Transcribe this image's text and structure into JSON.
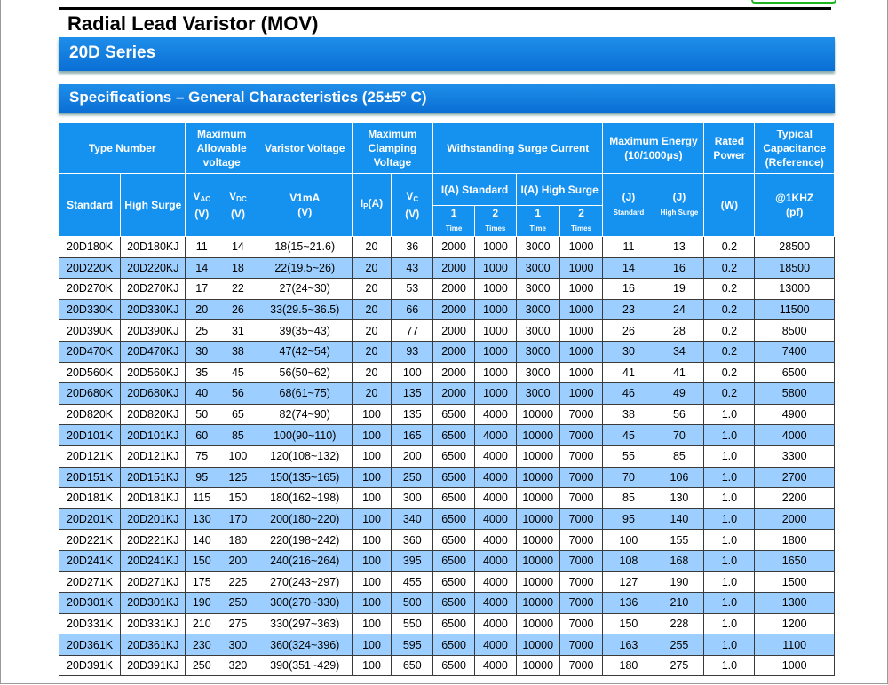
{
  "title": "Radial Lead Varistor (MOV)",
  "series": "20D Series",
  "section": "Specifications – General Characteristics (25±5° C)",
  "headers": {
    "type_number": "Type Number",
    "max_allowable_voltage": "Maximum Allowable voltage",
    "varistor_voltage": "Varistor Voltage",
    "max_clamping_voltage": "Maximum Clamping Voltage",
    "withstanding_surge": "Withstanding Surge Current",
    "max_energy": "Maximum Energy (10/1000μs)",
    "rated_power": "Rated Power",
    "typical_capacitance": "Typical Capacitance (Reference)",
    "standard": "Standard",
    "high_surge": "High Surge",
    "vac_unit": "(V)",
    "vdc_unit": "(V)",
    "v1ma": "V1mA",
    "v1ma_unit": "(V)",
    "ip_unit": "(A)",
    "vc_unit": "(V)",
    "ia_standard": "I(A) Standard",
    "ia_high_surge": "I(A) High Surge",
    "one": "1",
    "two": "2",
    "time": "Time",
    "times": "Times",
    "energy_std_unit": "(J)",
    "energy_std_label": "Standard",
    "energy_hs_unit": "(J)",
    "energy_hs_label": "High Surge",
    "power_unit": "(W)",
    "cap_freq": "@1KHZ",
    "cap_unit": "(pf)"
  },
  "rows": [
    [
      "20D180K",
      "20D180KJ",
      "11",
      "14",
      "18(15~21.6)",
      "20",
      "36",
      "2000",
      "1000",
      "3000",
      "1000",
      "11",
      "13",
      "0.2",
      "28500"
    ],
    [
      "20D220K",
      "20D220KJ",
      "14",
      "18",
      "22(19.5~26)",
      "20",
      "43",
      "2000",
      "1000",
      "3000",
      "1000",
      "14",
      "16",
      "0.2",
      "18500"
    ],
    [
      "20D270K",
      "20D270KJ",
      "17",
      "22",
      "27(24~30)",
      "20",
      "53",
      "2000",
      "1000",
      "3000",
      "1000",
      "16",
      "19",
      "0.2",
      "13000"
    ],
    [
      "20D330K",
      "20D330KJ",
      "20",
      "26",
      "33(29.5~36.5)",
      "20",
      "66",
      "2000",
      "1000",
      "3000",
      "1000",
      "23",
      "24",
      "0.2",
      "11500"
    ],
    [
      "20D390K",
      "20D390KJ",
      "25",
      "31",
      "39(35~43)",
      "20",
      "77",
      "2000",
      "1000",
      "3000",
      "1000",
      "26",
      "28",
      "0.2",
      "8500"
    ],
    [
      "20D470K",
      "20D470KJ",
      "30",
      "38",
      "47(42~54)",
      "20",
      "93",
      "2000",
      "1000",
      "3000",
      "1000",
      "30",
      "34",
      "0.2",
      "7400"
    ],
    [
      "20D560K",
      "20D560KJ",
      "35",
      "45",
      "56(50~62)",
      "20",
      "100",
      "2000",
      "1000",
      "3000",
      "1000",
      "41",
      "41",
      "0.2",
      "6500"
    ],
    [
      "20D680K",
      "20D680KJ",
      "40",
      "56",
      "68(61~75)",
      "20",
      "135",
      "2000",
      "1000",
      "3000",
      "1000",
      "46",
      "49",
      "0.2",
      "5800"
    ],
    [
      "20D820K",
      "20D820KJ",
      "50",
      "65",
      "82(74~90)",
      "100",
      "135",
      "6500",
      "4000",
      "10000",
      "7000",
      "38",
      "56",
      "1.0",
      "4900"
    ],
    [
      "20D101K",
      "20D101KJ",
      "60",
      "85",
      "100(90~110)",
      "100",
      "165",
      "6500",
      "4000",
      "10000",
      "7000",
      "45",
      "70",
      "1.0",
      "4000"
    ],
    [
      "20D121K",
      "20D121KJ",
      "75",
      "100",
      "120(108~132)",
      "100",
      "200",
      "6500",
      "4000",
      "10000",
      "7000",
      "55",
      "85",
      "1.0",
      "3300"
    ],
    [
      "20D151K",
      "20D151KJ",
      "95",
      "125",
      "150(135~165)",
      "100",
      "250",
      "6500",
      "4000",
      "10000",
      "7000",
      "70",
      "106",
      "1.0",
      "2700"
    ],
    [
      "20D181K",
      "20D181KJ",
      "115",
      "150",
      "180(162~198)",
      "100",
      "300",
      "6500",
      "4000",
      "10000",
      "7000",
      "85",
      "130",
      "1.0",
      "2200"
    ],
    [
      "20D201K",
      "20D201KJ",
      "130",
      "170",
      "200(180~220)",
      "100",
      "340",
      "6500",
      "4000",
      "10000",
      "7000",
      "95",
      "140",
      "1.0",
      "2000"
    ],
    [
      "20D221K",
      "20D221KJ",
      "140",
      "180",
      "220(198~242)",
      "100",
      "360",
      "6500",
      "4000",
      "10000",
      "7000",
      "100",
      "155",
      "1.0",
      "1800"
    ],
    [
      "20D241K",
      "20D241KJ",
      "150",
      "200",
      "240(216~264)",
      "100",
      "395",
      "6500",
      "4000",
      "10000",
      "7000",
      "108",
      "168",
      "1.0",
      "1650"
    ],
    [
      "20D271K",
      "20D271KJ",
      "175",
      "225",
      "270(243~297)",
      "100",
      "455",
      "6500",
      "4000",
      "10000",
      "7000",
      "127",
      "190",
      "1.0",
      "1500"
    ],
    [
      "20D301K",
      "20D301KJ",
      "190",
      "250",
      "300(270~330)",
      "100",
      "500",
      "6500",
      "4000",
      "10000",
      "7000",
      "136",
      "210",
      "1.0",
      "1300"
    ],
    [
      "20D331K",
      "20D331KJ",
      "210",
      "275",
      "330(297~363)",
      "100",
      "550",
      "6500",
      "4000",
      "10000",
      "7000",
      "150",
      "228",
      "1.0",
      "1200"
    ],
    [
      "20D361K",
      "20D361KJ",
      "230",
      "300",
      "360(324~396)",
      "100",
      "595",
      "6500",
      "4000",
      "10000",
      "7000",
      "163",
      "255",
      "1.0",
      "1100"
    ],
    [
      "20D391K",
      "20D391KJ",
      "250",
      "320",
      "390(351~429)",
      "100",
      "650",
      "6500",
      "4000",
      "10000",
      "7000",
      "180",
      "275",
      "1.0",
      "1000"
    ]
  ]
}
